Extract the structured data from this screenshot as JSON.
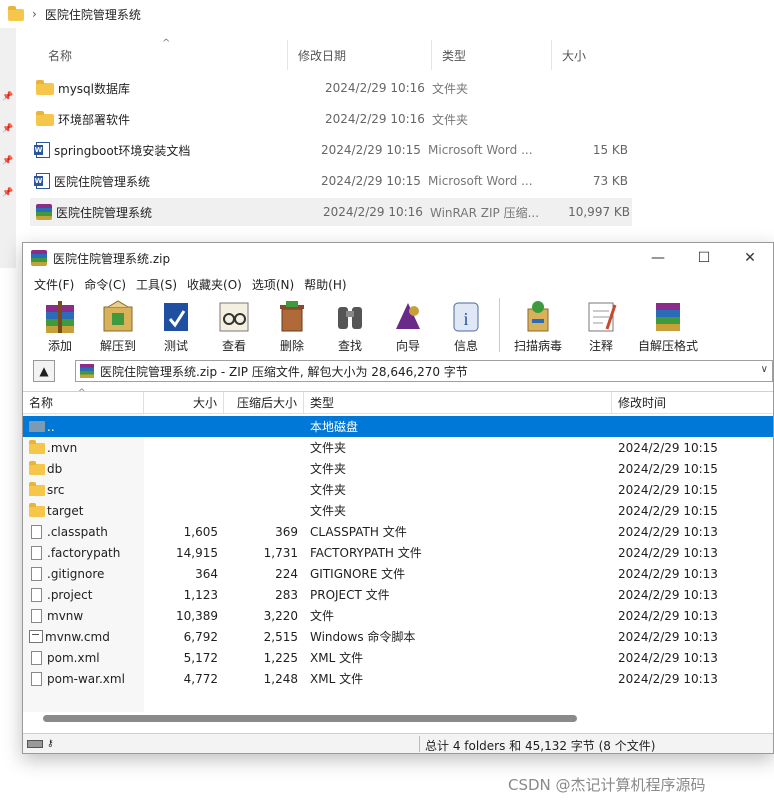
{
  "explorer": {
    "breadcrumb": "医院住院管理系统",
    "columns": {
      "name": "名称",
      "date": "修改日期",
      "type": "类型",
      "size": "大小"
    },
    "rows": [
      {
        "name": "mysql数据库",
        "date": "2024/2/29 10:16",
        "type": "文件夹",
        "size": "",
        "icon": "folder-icon"
      },
      {
        "name": "环境部署软件",
        "date": "2024/2/29 10:16",
        "type": "文件夹",
        "size": "",
        "icon": "folder-icon"
      },
      {
        "name": "springboot环境安装文档",
        "date": "2024/2/29 10:15",
        "type": "Microsoft Word ...",
        "size": "15 KB",
        "icon": "word-icon"
      },
      {
        "name": "医院住院管理系统",
        "date": "2024/2/29 10:15",
        "type": "Microsoft Word ...",
        "size": "73 KB",
        "icon": "word-icon"
      },
      {
        "name": "医院住院管理系统",
        "date": "2024/2/29 10:16",
        "type": "WinRAR ZIP 压缩...",
        "size": "10,997 KB",
        "icon": "winrar-icon"
      }
    ]
  },
  "winrar": {
    "title": "医院住院管理系统.zip",
    "controls": {
      "minimize": "—",
      "maximize": "☐",
      "close": "✕"
    },
    "menu": [
      "文件(F)",
      "命令(C)",
      "工具(S)",
      "收藏夹(O)",
      "选项(N)",
      "帮助(H)"
    ],
    "toolbar": {
      "add": "添加",
      "extract_to": "解压到",
      "test": "测试",
      "view": "查看",
      "delete": "删除",
      "find": "查找",
      "wizard": "向导",
      "info": "信息",
      "virus_scan": "扫描病毒",
      "comment": "注释",
      "sfx": "自解压格式"
    },
    "address": "医院住院管理系统.zip - ZIP 压缩文件, 解包大小为 28,646,270 字节",
    "columns": {
      "name": "名称",
      "size": "大小",
      "packed": "压缩后大小",
      "type": "类型",
      "modified": "修改时间"
    },
    "files": [
      {
        "name": "..",
        "size": "",
        "packed": "",
        "type": "本地磁盘",
        "modified": "",
        "icon": "up-folder-icon"
      },
      {
        "name": ".mvn",
        "size": "",
        "packed": "",
        "type": "文件夹",
        "modified": "2024/2/29 10:15",
        "icon": "folder-icon"
      },
      {
        "name": "db",
        "size": "",
        "packed": "",
        "type": "文件夹",
        "modified": "2024/2/29 10:15",
        "icon": "folder-icon"
      },
      {
        "name": "src",
        "size": "",
        "packed": "",
        "type": "文件夹",
        "modified": "2024/2/29 10:15",
        "icon": "folder-icon"
      },
      {
        "name": "target",
        "size": "",
        "packed": "",
        "type": "文件夹",
        "modified": "2024/2/29 10:15",
        "icon": "folder-icon"
      },
      {
        "name": ".classpath",
        "size": "1,605",
        "packed": "369",
        "type": "CLASSPATH 文件",
        "modified": "2024/2/29 10:13",
        "icon": "file-icon"
      },
      {
        "name": ".factorypath",
        "size": "14,915",
        "packed": "1,731",
        "type": "FACTORYPATH 文件",
        "modified": "2024/2/29 10:13",
        "icon": "file-icon"
      },
      {
        "name": ".gitignore",
        "size": "364",
        "packed": "224",
        "type": "GITIGNORE 文件",
        "modified": "2024/2/29 10:13",
        "icon": "file-icon"
      },
      {
        "name": ".project",
        "size": "1,123",
        "packed": "283",
        "type": "PROJECT 文件",
        "modified": "2024/2/29 10:13",
        "icon": "file-icon"
      },
      {
        "name": "mvnw",
        "size": "10,389",
        "packed": "3,220",
        "type": "文件",
        "modified": "2024/2/29 10:13",
        "icon": "file-icon"
      },
      {
        "name": "mvnw.cmd",
        "size": "6,792",
        "packed": "2,515",
        "type": "Windows 命令脚本",
        "modified": "2024/2/29 10:13",
        "icon": "cmd-icon"
      },
      {
        "name": "pom.xml",
        "size": "5,172",
        "packed": "1,225",
        "type": "XML 文件",
        "modified": "2024/2/29 10:13",
        "icon": "file-icon"
      },
      {
        "name": "pom-war.xml",
        "size": "4,772",
        "packed": "1,248",
        "type": "XML 文件",
        "modified": "2024/2/29 10:13",
        "icon": "file-icon"
      }
    ],
    "status": "总计 4 folders 和 45,132 字节 (8 个文件)"
  },
  "watermark": "CSDN @杰记计算机程序源码"
}
